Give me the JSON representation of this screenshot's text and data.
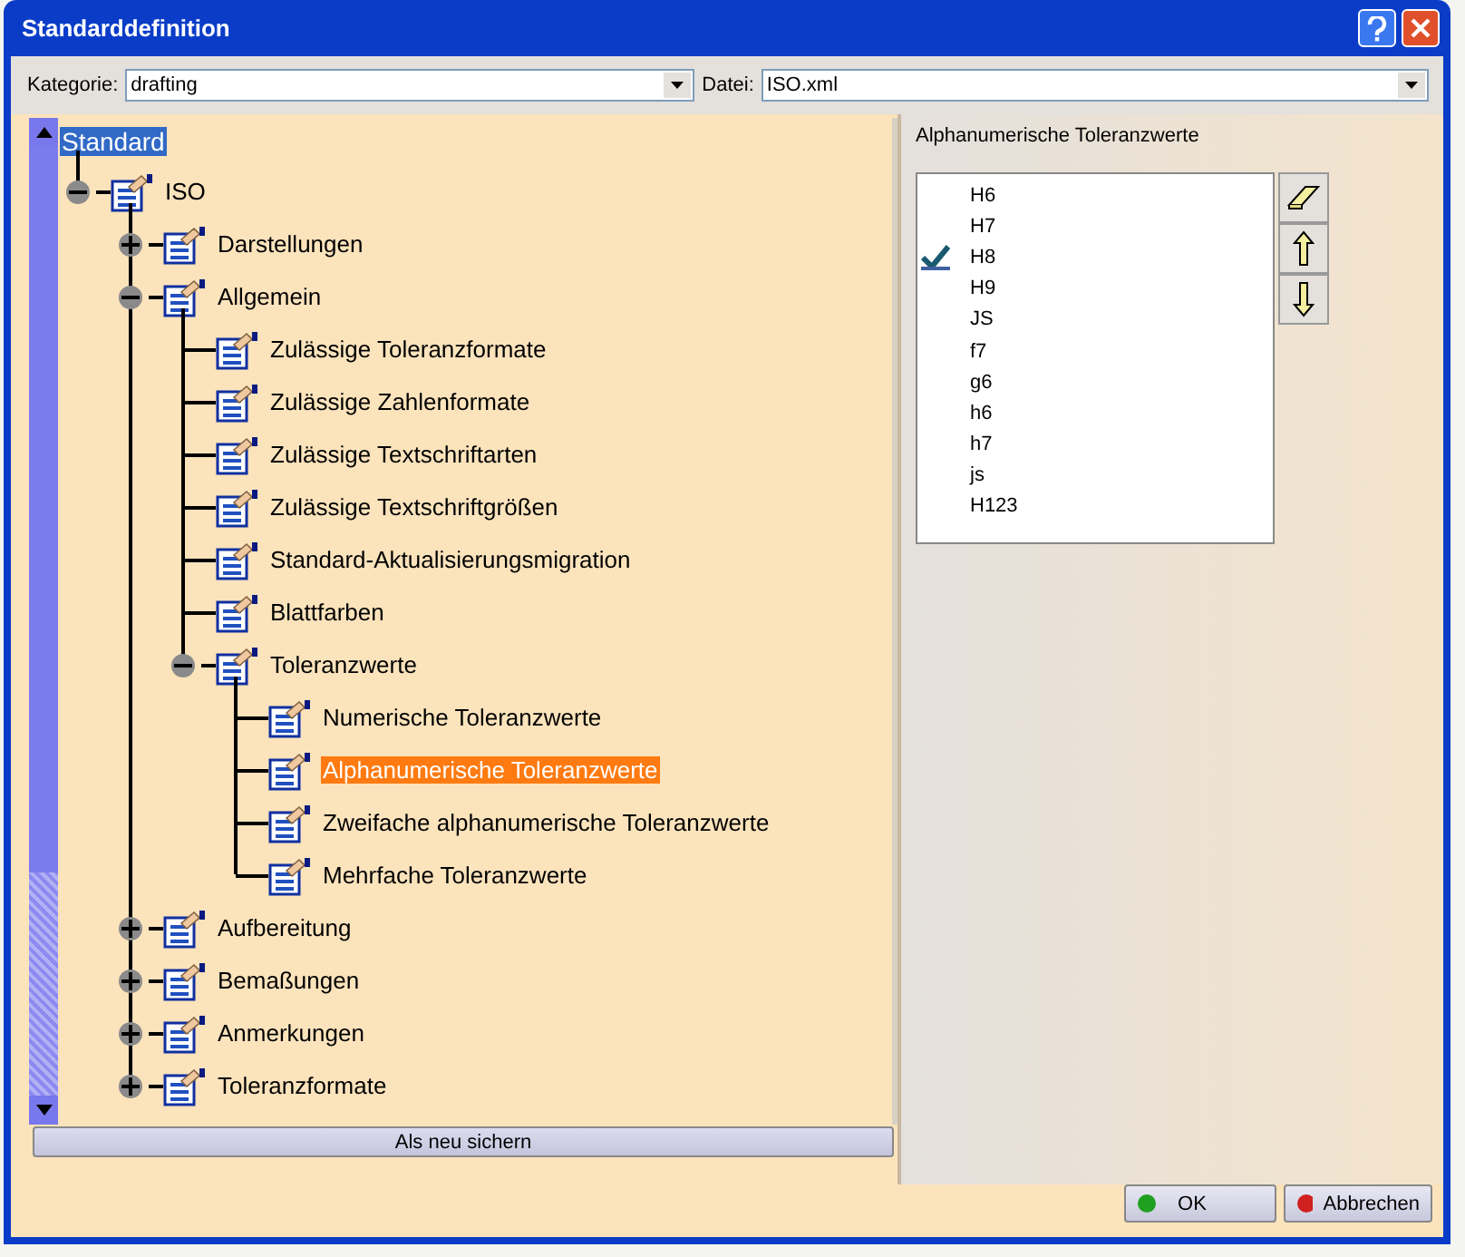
{
  "window": {
    "title": "Standarddefinition"
  },
  "kategorie": {
    "label": "Kategorie:",
    "value": "drafting"
  },
  "datei": {
    "label": "Datei:",
    "value": "ISO.xml"
  },
  "tree": {
    "label": "Standard",
    "focused": true,
    "children": [
      {
        "label": "ISO",
        "expanded": true,
        "selected": false,
        "children": [
          {
            "label": "Darstellungen",
            "expanded": false,
            "selected": false
          },
          {
            "label": "Allgemein",
            "expanded": true,
            "selected": false,
            "children": [
              {
                "label": "Zulässige Toleranzformate",
                "selected": false
              },
              {
                "label": "Zulässige Zahlenformate",
                "selected": false
              },
              {
                "label": "Zulässige Textschriftarten",
                "selected": false
              },
              {
                "label": "Zulässige Textschriftgrößen",
                "selected": false
              },
              {
                "label": "Standard-Aktualisierungsmigration",
                "selected": false
              },
              {
                "label": "Blattfarben",
                "selected": false
              },
              {
                "label": "Toleranzwerte",
                "expanded": true,
                "selected": false,
                "children": [
                  {
                    "label": "Numerische Toleranzwerte",
                    "selected": false
                  },
                  {
                    "label": "Alphanumerische Toleranzwerte",
                    "selected": true
                  },
                  {
                    "label": "Zweifache alphanumerische Toleranzwerte",
                    "selected": false
                  },
                  {
                    "label": "Mehrfache Toleranzwerte",
                    "selected": false
                  }
                ]
              }
            ]
          },
          {
            "label": "Aufbereitung",
            "expanded": false,
            "selected": false
          },
          {
            "label": "Bemaßungen",
            "expanded": false,
            "selected": false
          },
          {
            "label": "Anmerkungen",
            "expanded": false,
            "selected": false
          },
          {
            "label": "Toleranzformate",
            "expanded": false,
            "selected": false
          }
        ]
      }
    ]
  },
  "save_button": "Als neu sichern",
  "panel": {
    "title": "Alphanumerische Toleranzwerte",
    "items": [
      {
        "label": "H6",
        "checked": false
      },
      {
        "label": "H7",
        "checked": false
      },
      {
        "label": "H8",
        "checked": true
      },
      {
        "label": "H9",
        "checked": false
      },
      {
        "label": "JS",
        "checked": false
      },
      {
        "label": "f7",
        "checked": false
      },
      {
        "label": "g6",
        "checked": false
      },
      {
        "label": "h6",
        "checked": false
      },
      {
        "label": "h7",
        "checked": false
      },
      {
        "label": "js",
        "checked": false
      },
      {
        "label": "H123",
        "checked": false
      }
    ]
  },
  "buttons": [
    {
      "label": "OK",
      "kind": "ok"
    },
    {
      "label": "Abbrechen",
      "kind": "cancel"
    }
  ]
}
